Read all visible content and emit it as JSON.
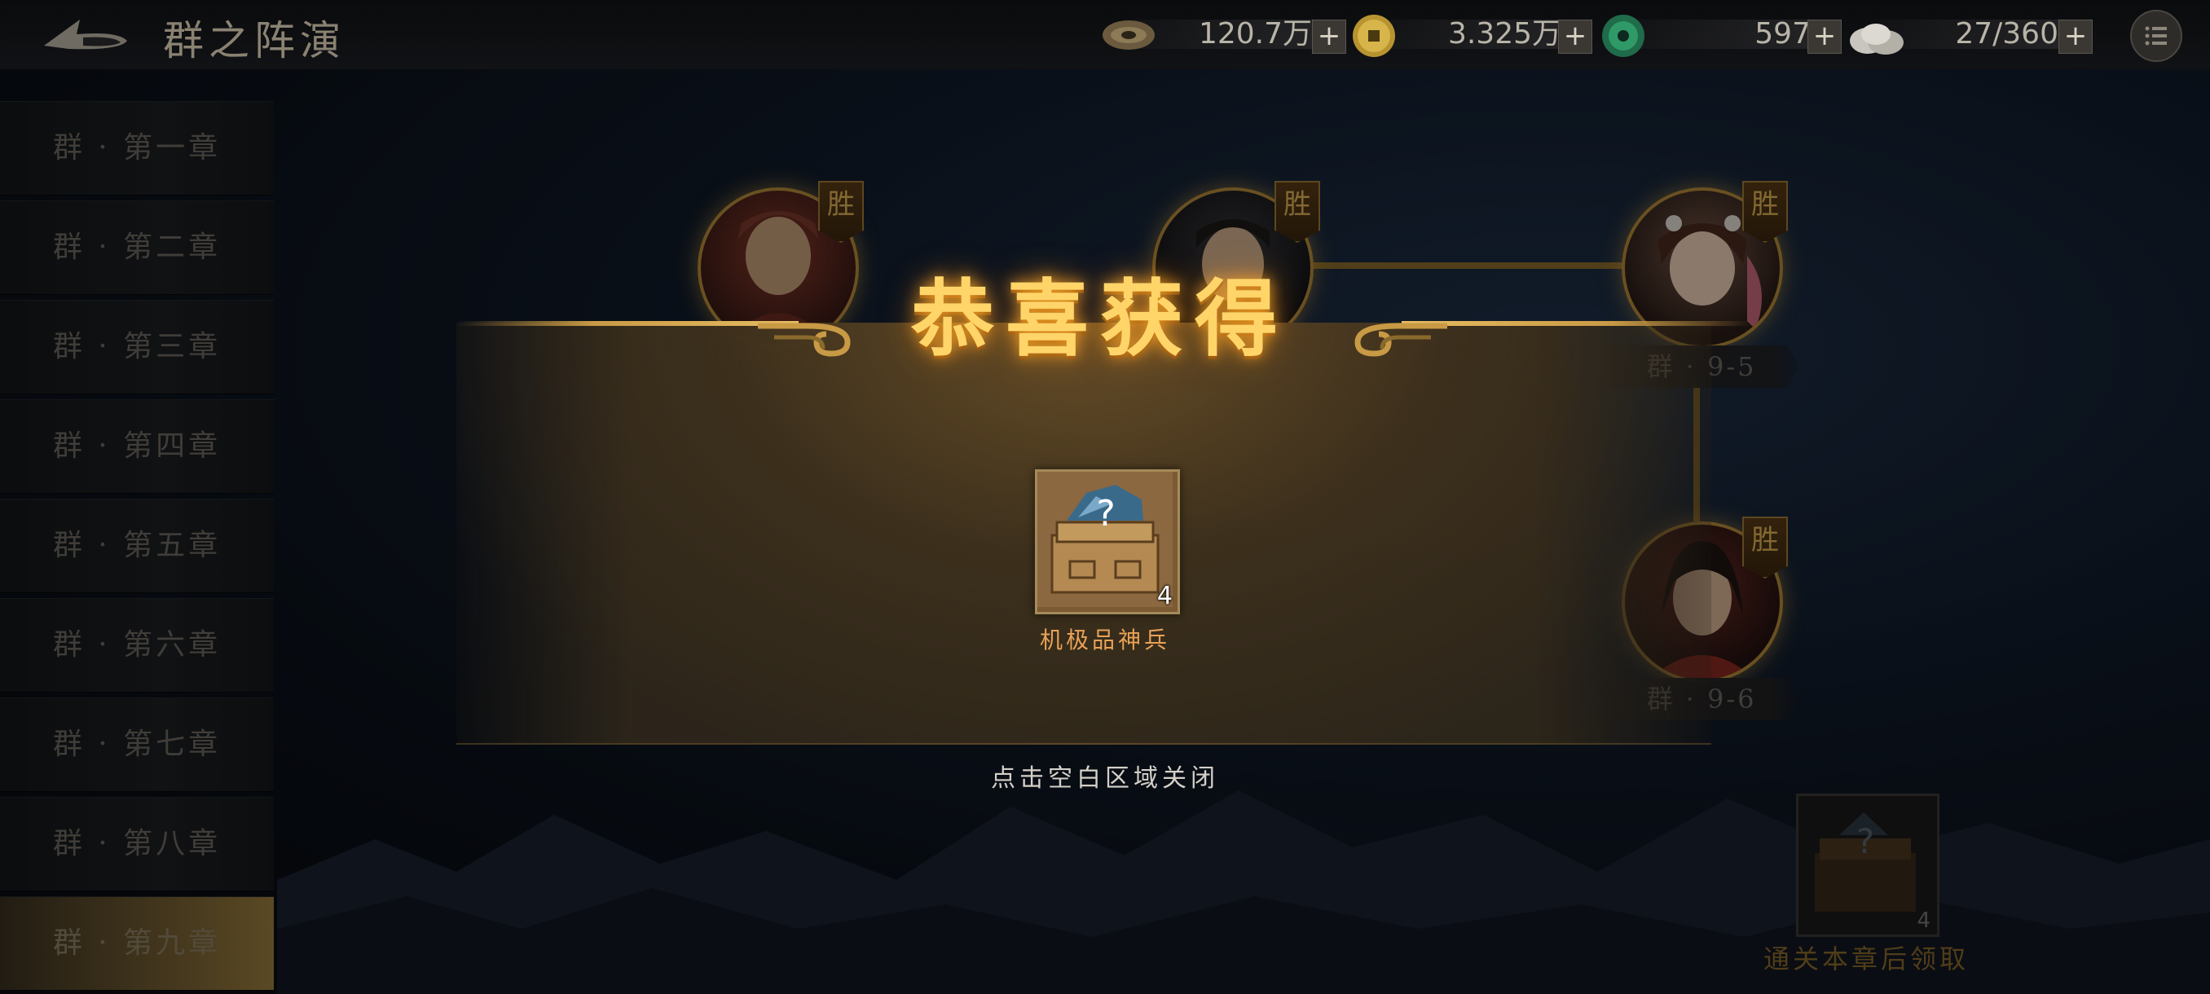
{
  "header": {
    "title": "群之阵演",
    "resources": [
      {
        "name": "jade-bi",
        "icon": "jade-bi-icon",
        "value": "120.7万"
      },
      {
        "name": "copper-coin",
        "icon": "coin-icon",
        "value": "3.325万"
      },
      {
        "name": "jade-disc",
        "icon": "jade-disc-icon",
        "value": "597"
      },
      {
        "name": "stamina",
        "icon": "bun-icon",
        "value": "27/360"
      }
    ],
    "plus_label": "+"
  },
  "sidebar": {
    "chapters": [
      {
        "label": "群 · 第一章"
      },
      {
        "label": "群 · 第二章"
      },
      {
        "label": "群 · 第三章"
      },
      {
        "label": "群 · 第四章"
      },
      {
        "label": "群 · 第五章"
      },
      {
        "label": "群 · 第六章"
      },
      {
        "label": "群 · 第七章"
      },
      {
        "label": "群 · 第八章"
      },
      {
        "label": "群 · 第九章"
      }
    ],
    "active_index": 8
  },
  "stages": {
    "win_badge": "胜",
    "labels": {
      "stage_9_5": "群 · 9-5",
      "stage_9_6": "群 · 9-6"
    }
  },
  "chapter_reward": {
    "quantity": "4",
    "caption": "通关本章后领取"
  },
  "popup": {
    "title": "恭喜获得",
    "item_name": "机极品神兵",
    "item_quantity": "4",
    "close_hint": "点击空白区域关闭"
  },
  "colors": {
    "accent_gold": "#e7bd62",
    "title_gold": "#ffd56a",
    "item_name": "#e9a256",
    "active_chapter": "#9c7f3e"
  }
}
